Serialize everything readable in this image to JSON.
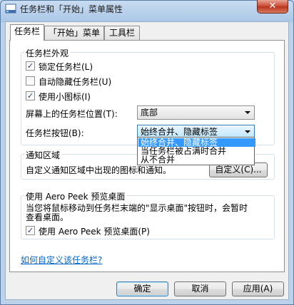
{
  "window": {
    "title": "任务栏和「开始」菜单属性",
    "close_glyph": "✕"
  },
  "tabs": [
    {
      "label": "任务栏",
      "active": true
    },
    {
      "label": "「开始」菜单",
      "active": false
    },
    {
      "label": "工具栏",
      "active": false
    }
  ],
  "appearance": {
    "legend": "任务栏外观",
    "lock_taskbar": {
      "label": "锁定任务栏(L)",
      "checked": true,
      "mark": "✓"
    },
    "auto_hide": {
      "label": "自动隐藏任务栏(U)",
      "checked": false,
      "mark": ""
    },
    "small_icons": {
      "label": "使用小图标(I)",
      "checked": true,
      "mark": "✓"
    },
    "location_label": "屏幕上的任务栏位置(T):",
    "location_value": "底部",
    "buttons_label": "任务栏按钮(B):",
    "buttons_value": "始终合并、隐藏标签",
    "buttons_options": [
      "始终合并、隐藏标签",
      "当任务栏被占满时合并",
      "从不合并"
    ]
  },
  "notification": {
    "legend": "通知区域",
    "text": "自定义通知区域中出现的图标和通知。",
    "customize_button": "自定义(C)..."
  },
  "aero_peek": {
    "legend": "使用 Aero Peek 预览桌面",
    "description_line1": "当您将鼠标移动到任务栏末端的\"显示桌面\"按钮时，会暂时",
    "description_line2": "查看桌面。",
    "checkbox": {
      "label": "使用 Aero Peek 预览桌面(P)",
      "checked": true,
      "mark": "✓"
    }
  },
  "help_link": "如何自定义该任务栏?",
  "footer": {
    "ok": "确定",
    "cancel": "取消",
    "apply": "应用(A)"
  },
  "colors": {
    "accent": "#3399ff",
    "link": "#0066cc",
    "close_button": "#c8472f"
  }
}
